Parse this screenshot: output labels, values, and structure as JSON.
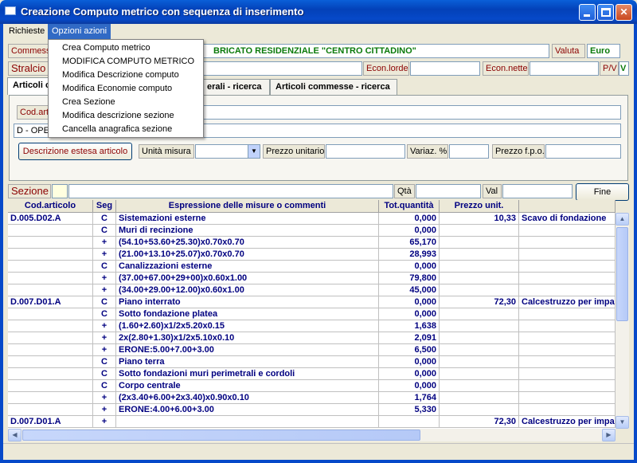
{
  "window": {
    "title": "Creazione Computo metrico con sequenza di inserimento"
  },
  "menu": {
    "items": [
      "Richieste",
      "Opzioni azioni"
    ]
  },
  "dropdown": {
    "items": [
      "Crea Computo metrico",
      "MODIFICA COMPUTO METRICO",
      "Modifica Descrizione computo",
      "Modifica Economie computo",
      "Crea Sezione",
      "Modifica descrizione sezione",
      "Cancella anagrafica sezione"
    ]
  },
  "header": {
    "commessa_label": "Commessa",
    "commessa_value": "BRICATO RESIDENZIALE \"CENTRO CITTADINO\"",
    "valuta_label": "Valuta",
    "valuta_value": "Euro",
    "stralcio_label": "Stralcio",
    "econ_lorde_label": "Econ.lorde",
    "econ_nette_label": "Econ.nette",
    "pv_label": "P/V",
    "pv_value": "V"
  },
  "tabs": [
    "Articoli c",
    "erali - ricerca",
    "Articoli commesse - ricerca"
  ],
  "panel": {
    "cod_label": "Cod.artic",
    "desc_value": "D - OPE",
    "desc_button": "Descrizione estesa articolo",
    "unita_label": "Unità misura",
    "prezzo_label": "Prezzo unitario",
    "variaz_label": "Variaz. %",
    "prezzo_fpo_label": "Prezzo f.p.o."
  },
  "sezione": {
    "label": "Sezione",
    "qta_label": "Qtà",
    "val_label": "Val",
    "fine_button": "Fine"
  },
  "grid": {
    "columns": [
      "Cod.articolo",
      "Seg",
      "Espressione delle misure o commenti",
      "Tot.quantità",
      "Prezzo unit.",
      ""
    ],
    "rows": [
      [
        "D.005.D02.A",
        "C",
        "Sistemazioni esterne",
        "0,000",
        "10,33",
        "Scavo di fondazione"
      ],
      [
        "",
        "C",
        "Muri di recinzione",
        "0,000",
        "",
        ""
      ],
      [
        "",
        "+",
        "(54.10+53.60+25.30)x0.70x0.70",
        "65,170",
        "",
        ""
      ],
      [
        "",
        "+",
        "(21.00+13.10+25.07)x0.70x0.70",
        "28,993",
        "",
        ""
      ],
      [
        "",
        "C",
        "Canalizzazioni esterne",
        "0,000",
        "",
        ""
      ],
      [
        "",
        "+",
        "(37.00+67.00+29+00)x0.60x1.00",
        "79,800",
        "",
        ""
      ],
      [
        "",
        "+",
        "(34.00+29.00+12.00)x0.60x1.00",
        "45,000",
        "",
        ""
      ],
      [
        "D.007.D01.A",
        "C",
        "Piano interrato",
        "0,000",
        "72,30",
        "Calcestruzzo per impa"
      ],
      [
        "",
        "C",
        "Sotto fondazione platea",
        "0,000",
        "",
        ""
      ],
      [
        "",
        "+",
        "(1.60+2.60)x1/2x5.20x0.15",
        "1,638",
        "",
        ""
      ],
      [
        "",
        "+",
        "2x(2.80+1.30)x1/2x5.10x0.10",
        "2,091",
        "",
        ""
      ],
      [
        "",
        "+",
        "ERONE:5.00+7.00+3.00",
        "6,500",
        "",
        ""
      ],
      [
        "",
        "C",
        "Piano terra",
        "0,000",
        "",
        ""
      ],
      [
        "",
        "C",
        "Sotto fondazioni muri perimetrali e cordoli",
        "0,000",
        "",
        ""
      ],
      [
        "",
        "C",
        "Corpo centrale",
        "0,000",
        "",
        ""
      ],
      [
        "",
        "+",
        "(2x3.40+6.00+2x3.40)x0.90x0.10",
        "1,764",
        "",
        ""
      ],
      [
        "",
        "+",
        "ERONE:4.00+6.00+3.00",
        "5,330",
        "",
        ""
      ],
      [
        "D.007.D01.A",
        "+",
        "",
        "",
        "72,30",
        "Calcestruzzo per impa"
      ]
    ]
  }
}
